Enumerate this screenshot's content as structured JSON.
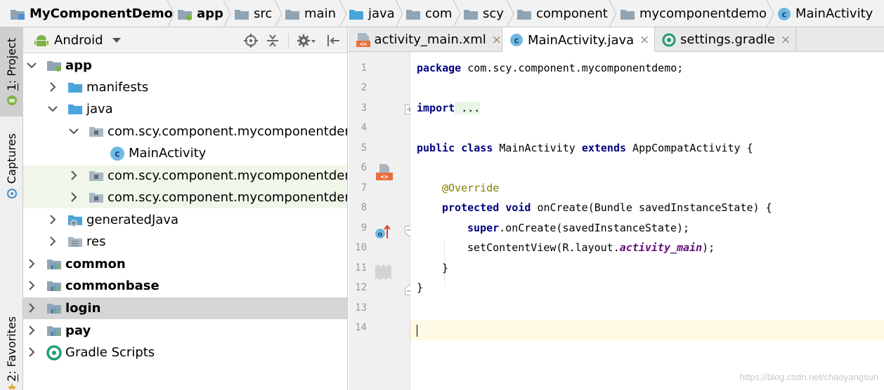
{
  "breadcrumb": [
    {
      "label": "MyComponentDemo",
      "icon": "project-folder-icon"
    },
    {
      "label": "app",
      "icon": "module-folder-icon"
    },
    {
      "label": "src",
      "icon": "folder-icon"
    },
    {
      "label": "main",
      "icon": "folder-icon"
    },
    {
      "label": "java",
      "icon": "source-folder-icon"
    },
    {
      "label": "com",
      "icon": "folder-icon"
    },
    {
      "label": "scy",
      "icon": "folder-icon"
    },
    {
      "label": "component",
      "icon": "folder-icon"
    },
    {
      "label": "mycomponentdemo",
      "icon": "folder-icon"
    },
    {
      "label": "MainActivity",
      "icon": "java-class-icon"
    }
  ],
  "tool_tabs": {
    "project": {
      "number": "1",
      "label": ": Project"
    },
    "captures": "Captures",
    "favorites": {
      "number": "2",
      "label": ": Favorites"
    }
  },
  "project_panel": {
    "view_mode": "Android",
    "tree": [
      {
        "label": "app",
        "bold": true,
        "expanded": true,
        "icon": "android-module-icon"
      },
      {
        "label": "manifests",
        "expanded": false,
        "icon": "folder-icon"
      },
      {
        "label": "java",
        "expanded": true,
        "icon": "source-folder-icon"
      },
      {
        "label": "com.scy.component.mycomponentdemo",
        "expanded": true,
        "icon": "package-icon"
      },
      {
        "label": "MainActivity",
        "icon": "java-class-icon"
      },
      {
        "label": "com.scy.component.mycomponentdemo",
        "expanded": false,
        "icon": "package-icon"
      },
      {
        "label": "com.scy.component.mycomponentdemo",
        "expanded": false,
        "icon": "package-icon"
      },
      {
        "label": "generatedJava",
        "expanded": false,
        "icon": "generated-folder-icon"
      },
      {
        "label": "res",
        "expanded": false,
        "icon": "resources-folder-icon"
      },
      {
        "label": "common",
        "bold": true,
        "expanded": false,
        "icon": "library-module-icon"
      },
      {
        "label": "commonbase",
        "bold": true,
        "expanded": false,
        "icon": "library-module-icon"
      },
      {
        "label": "login",
        "bold": true,
        "expanded": false,
        "icon": "library-module-icon"
      },
      {
        "label": "pay",
        "bold": true,
        "expanded": false,
        "icon": "library-module-icon"
      },
      {
        "label": "Gradle Scripts",
        "expanded": false,
        "icon": "gradle-icon"
      }
    ]
  },
  "editor": {
    "tabs": [
      {
        "label": "activity_main.xml",
        "icon": "xml-file-icon",
        "active": false
      },
      {
        "label": "MainActivity.java",
        "icon": "java-class-icon",
        "active": true
      },
      {
        "label": "settings.gradle",
        "icon": "gradle-icon",
        "active": false
      }
    ],
    "close_glyph": "×",
    "line_numbers": [
      "1",
      "2",
      "3",
      "4",
      "5",
      "6",
      "7",
      "8",
      "9",
      "10",
      "11",
      "12",
      "13",
      "14"
    ],
    "code": {
      "l1_kw": "package",
      "l1_rest": " com.scy.component.mycomponentdemo;",
      "l3_kw": "import",
      "l3_fold": " ...",
      "l6_kw1": "public",
      "l6_kw2": "class",
      "l6_name": " MainActivity ",
      "l6_kw3": "extends",
      "l6_rest": " AppCompatActivity {",
      "l8_ann": "@Override",
      "l9_kw1": "protected",
      "l9_kw2": "void",
      "l9_rest": " onCreate(Bundle savedInstanceState) {",
      "l10_kw": "super",
      "l10_rest": ".onCreate(savedInstanceState);",
      "l11_pre": "setContentView(R.layout.",
      "l11_fld": "activity_main",
      "l11_post": ");",
      "l12": "}",
      "l13": "}"
    }
  },
  "watermark": "https://blog.csdn.net/chaoyangsun"
}
